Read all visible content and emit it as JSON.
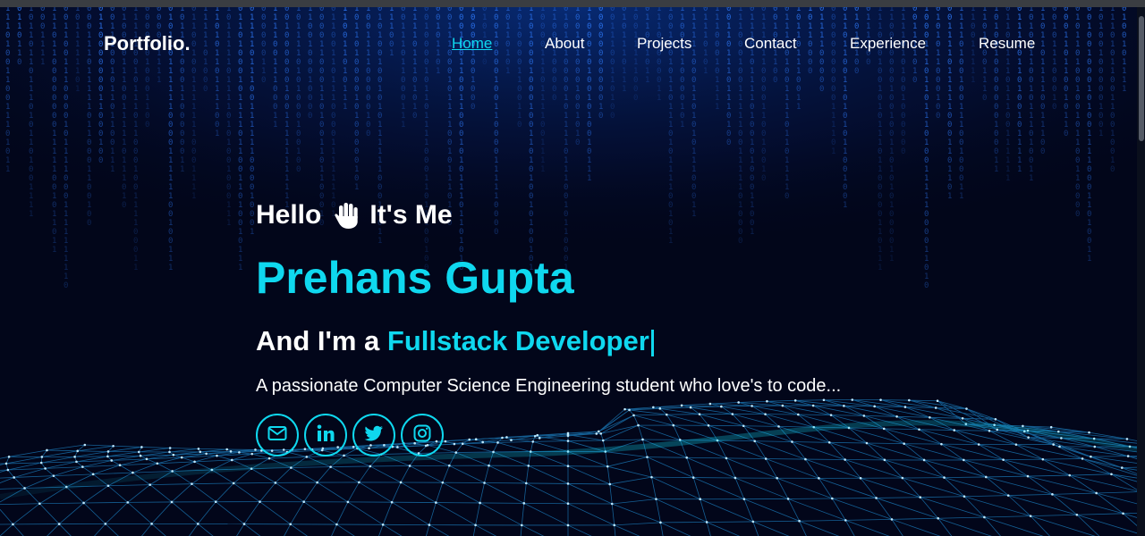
{
  "brand": {
    "logo": "Portfolio",
    "logo_dot": "."
  },
  "nav": {
    "home": "Home",
    "about": "About",
    "projects": "Projects",
    "contact": "Contact",
    "experience": "Experience",
    "resume": "Resume"
  },
  "hero": {
    "hello": "Hello",
    "its_me": "It's Me",
    "name": "Prehans Gupta",
    "role_prefix": "And I'm a",
    "role": "Fullstack Developer",
    "description": "A passionate Computer Science Engineering student who love's to code..."
  },
  "socials": [
    {
      "icon": "mail-icon"
    },
    {
      "icon": "linkedin-icon"
    },
    {
      "icon": "twitter-icon"
    },
    {
      "icon": "instagram-icon"
    }
  ],
  "colors": {
    "accent": "#0fd8ef",
    "background": "#02061a",
    "matrix": "#2f7cff"
  }
}
